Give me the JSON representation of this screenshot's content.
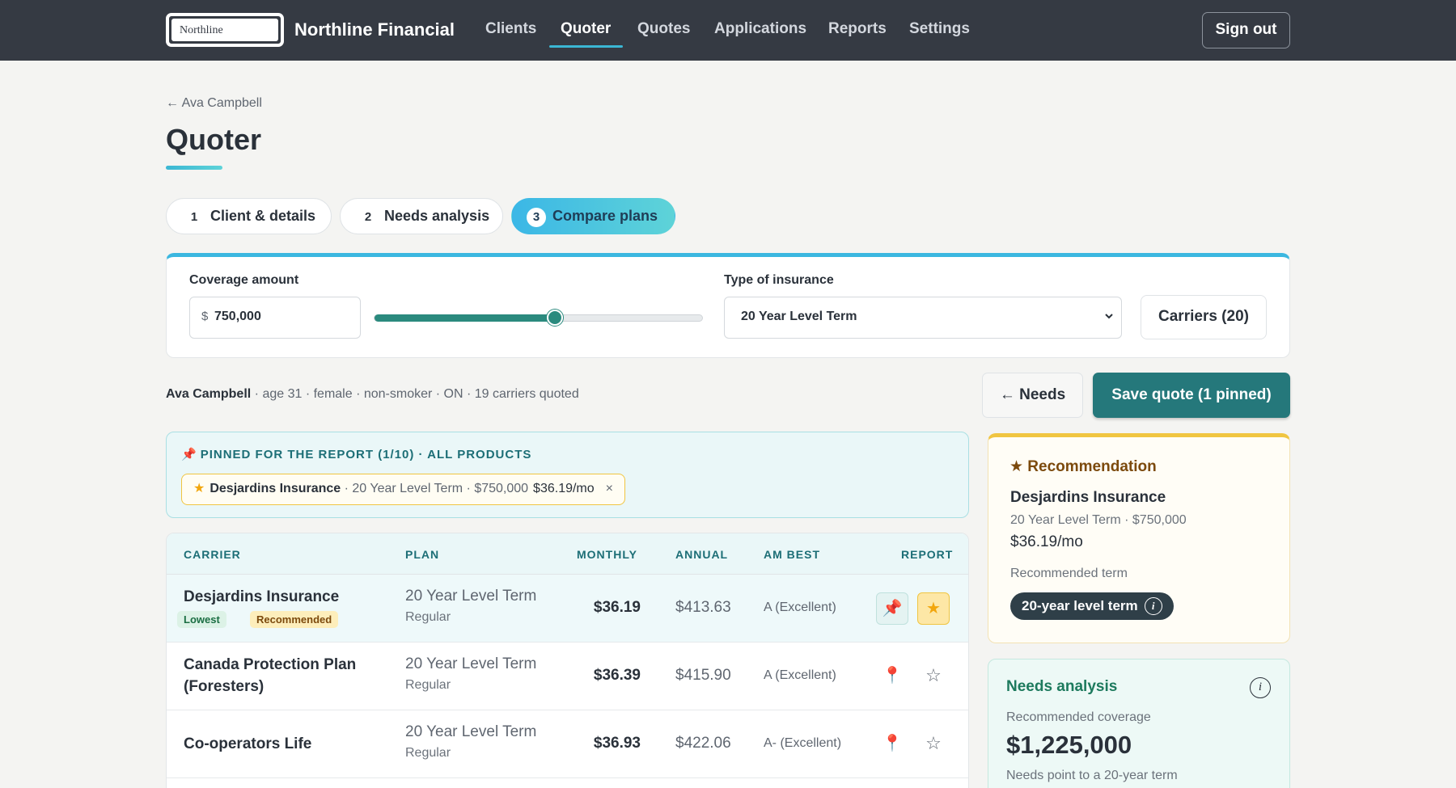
{
  "nav": {
    "logo_text": "Northline",
    "brand": "Northline Financial",
    "links": [
      "Clients",
      "Quoter",
      "Quotes",
      "Applications",
      "Reports",
      "Settings"
    ],
    "active": "Quoter",
    "sign_out": "Sign out"
  },
  "header": {
    "back": "← Ava Campbell",
    "title": "Quoter"
  },
  "steps": [
    {
      "num": "1",
      "label": "Client & details"
    },
    {
      "num": "2",
      "label": "Needs analysis"
    },
    {
      "num": "3",
      "label": "Compare plans",
      "active": true
    }
  ],
  "controls": {
    "coverage_label": "Coverage amount",
    "currency": "$",
    "coverage_value": "750,000",
    "slider_fraction": 0.55,
    "type_label": "Type of insurance",
    "type_value": "20 Year Level Term",
    "carriers_button": "Carriers (20)"
  },
  "summary": {
    "client": "Ava Campbell",
    "details": " · age 31 · female · non-smoker · ON · 19 carriers quoted"
  },
  "actions": {
    "needs": "← Needs",
    "save": "Save quote (1 pinned)"
  },
  "pinned": {
    "icon": "pin-icon",
    "heading": "PINNED FOR THE REPORT (1/10) · ALL PRODUCTS",
    "chip": {
      "carrier": "Desjardins Insurance",
      "detail": " · 20 Year Level Term · $750,000",
      "price": "$36.19/mo",
      "remove": "×"
    }
  },
  "table": {
    "headers": [
      "CARRIER",
      "PLAN",
      "MONTHLY",
      "ANNUAL",
      "AM BEST",
      "REPORT"
    ],
    "rows": [
      {
        "carrier": "Desjardins Insurance",
        "badges": [
          "Lowest",
          "Recommended"
        ],
        "plan": "20 Year Level Term",
        "plan_sub": "Regular",
        "monthly": "$36.19",
        "annual": "$413.63",
        "ambest": "A (Excellent)",
        "pinned": true,
        "starred": true
      },
      {
        "carrier": "Canada Protection Plan (Foresters)",
        "carrier_line1": "Canada Protection Plan",
        "carrier_line2": "(Foresters)",
        "plan": "20 Year Level Term",
        "plan_sub": "Regular",
        "monthly": "$36.39",
        "annual": "$415.90",
        "ambest": "A (Excellent)",
        "pinned": false,
        "starred": false
      },
      {
        "carrier": "Co-operators Life",
        "plan": "20 Year Level Term",
        "plan_sub": "Regular",
        "monthly": "$36.93",
        "annual": "$422.06",
        "ambest": "A- (Excellent)",
        "pinned": false,
        "starred": false
      }
    ]
  },
  "recommendation": {
    "heading": "★ Recommendation",
    "carrier": "Desjardins Insurance",
    "plan": "20 Year Level Term · $750,000",
    "price": "$36.19/mo",
    "term_label": "Recommended term",
    "term": "20-year level term"
  },
  "needs_analysis": {
    "heading": "Needs analysis",
    "coverage_label": "Recommended coverage",
    "coverage": "$1,225,000",
    "note": "Needs point to a 20-year term"
  },
  "colors": {
    "nav_bg": "#353a43",
    "accent_teal": "#25787b",
    "accent_cyan": "#3bb7e0",
    "star_gold": "#f2a60c"
  }
}
